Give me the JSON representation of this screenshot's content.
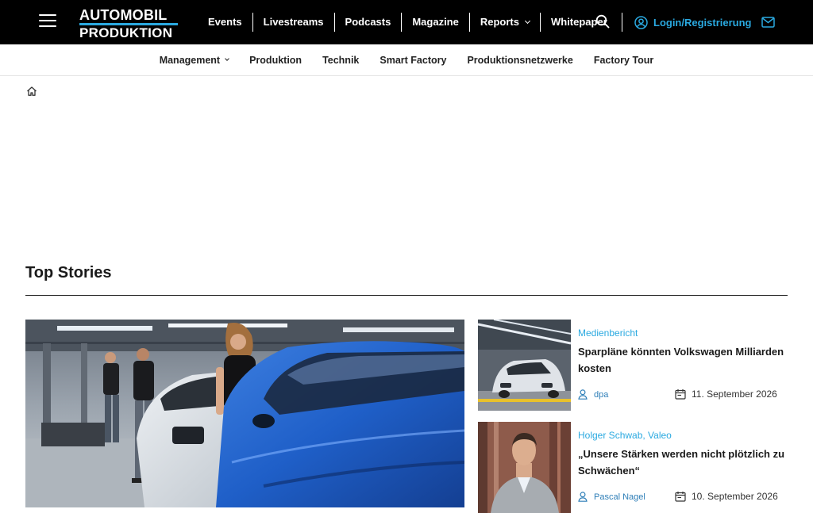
{
  "logo": {
    "line1": "AUTOMOBIL",
    "line2": "PRODUKTION"
  },
  "main_nav": [
    {
      "label": "Events"
    },
    {
      "label": "Livestreams"
    },
    {
      "label": "Podcasts"
    },
    {
      "label": "Magazine"
    },
    {
      "label": "Reports",
      "has_dropdown": true
    },
    {
      "label": "Whitepaper"
    }
  ],
  "login": {
    "label": "Login/Registrierung"
  },
  "sub_nav": [
    {
      "label": "Management",
      "has_dropdown": true
    },
    {
      "label": "Produktion"
    },
    {
      "label": "Technik"
    },
    {
      "label": "Smart Factory"
    },
    {
      "label": "Produktionsnetzwerke"
    },
    {
      "label": "Factory Tour"
    }
  ],
  "section": {
    "title": "Top Stories"
  },
  "stories": [
    {
      "kicker": "Medienbericht",
      "headline": "Sparpläne könnten Volkswagen Milliarden kosten",
      "author": "dpa",
      "date": "11. September 2026"
    },
    {
      "kicker": "Holger Schwab, Valeo",
      "headline": "„Unsere Stärken werden nicht plötzlich zu Schwächen“",
      "author": "Pascal Nagel",
      "date": "10. September 2026"
    }
  ],
  "colors": {
    "accent": "#2aa9e0",
    "topbar": "#000000"
  },
  "icons": [
    "menu-icon",
    "search-icon",
    "user-icon",
    "mail-icon",
    "home-icon",
    "calendar-icon",
    "chevron-down-icon"
  ]
}
